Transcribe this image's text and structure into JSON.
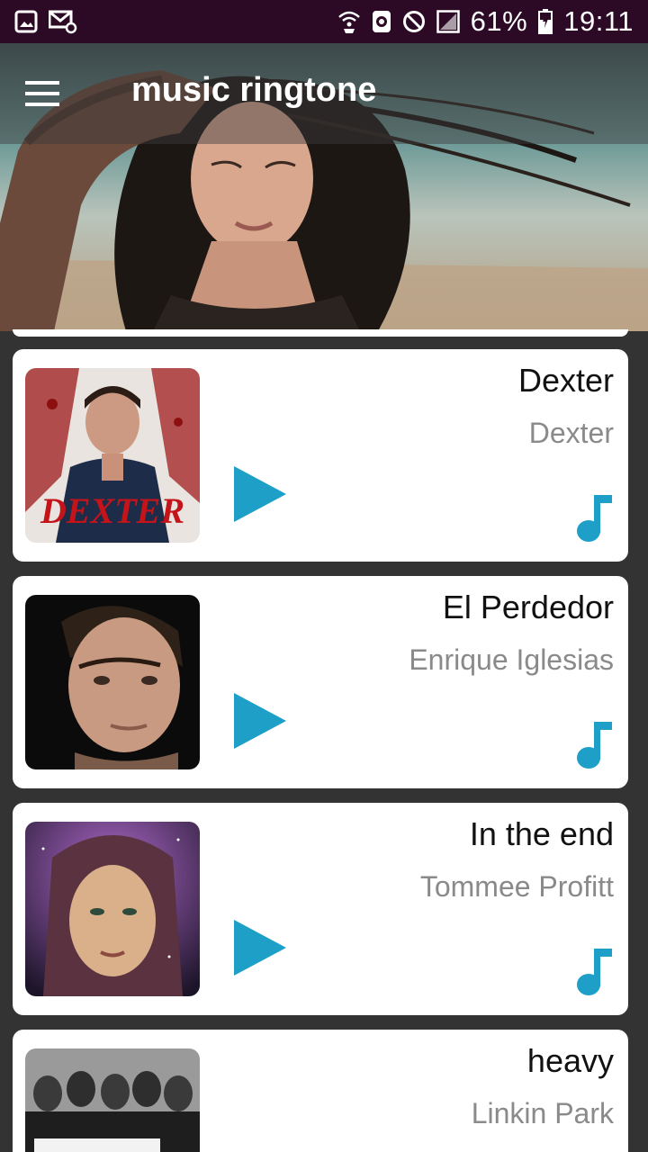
{
  "status_bar": {
    "battery": "61%",
    "time": "19:11",
    "icons": [
      "gallery-icon",
      "mail-settings-icon",
      "wifi-call-icon",
      "data-saver-icon",
      "do-not-disturb-icon",
      "signal-icon",
      "battery-charging-icon"
    ]
  },
  "app_bar": {
    "title": "music ringtone",
    "menu_icon": "hamburger-menu-icon"
  },
  "colors": {
    "status_bar": "#2c0a26",
    "accent": "#1e9fc8",
    "background": "#333333"
  },
  "songs": [
    {
      "title": "Dexter",
      "artist": "Dexter"
    },
    {
      "title": "El Perdedor",
      "artist": "Enrique Iglesias"
    },
    {
      "title": "In the end",
      "artist": "Tommee Profitt"
    },
    {
      "title": "heavy",
      "artist": "Linkin Park"
    }
  ]
}
